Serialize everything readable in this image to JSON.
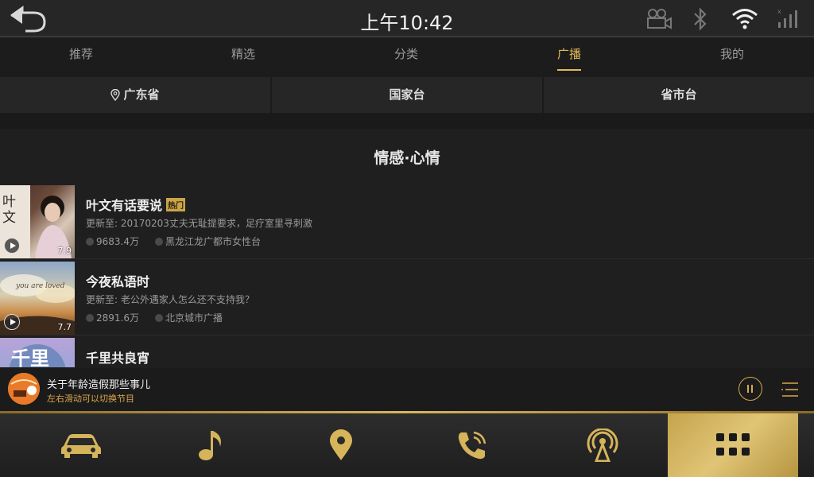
{
  "status_bar": {
    "time": "上午10:42",
    "icons": [
      "back-icon",
      "camera-icon",
      "bluetooth-icon",
      "wifi-icon",
      "signal-icon"
    ]
  },
  "tabs": [
    {
      "label": "推荐",
      "active": false
    },
    {
      "label": "精选",
      "active": false
    },
    {
      "label": "分类",
      "active": false
    },
    {
      "label": "广播",
      "active": true
    },
    {
      "label": "我的",
      "active": false
    }
  ],
  "filters": [
    {
      "label": "广东省",
      "icon": "location-pin-icon"
    },
    {
      "label": "国家台"
    },
    {
      "label": "省市台"
    }
  ],
  "section_title": "情感·心情",
  "programs": [
    {
      "title": "叶文有话要说",
      "badge": "热门",
      "update": "更新至: 20170203丈夫无耻提要求，足疗室里寻刺激",
      "plays": "9683.4万",
      "station": "黑龙江龙广都市女性台",
      "score": "7.9",
      "thumb_text": "叶文"
    },
    {
      "title": "今夜私语时",
      "badge": "",
      "update": "更新至: 老公外遇家人怎么还不支持我？",
      "plays": "2891.6万",
      "station": "北京城市广播",
      "score": "7.7",
      "thumb_text": "you are loved"
    },
    {
      "title": "千里共良宵",
      "badge": "",
      "update": "",
      "plays": "",
      "station": "",
      "score": "",
      "thumb_text": "千里"
    }
  ],
  "player": {
    "title": "关于年龄造假那些事儿",
    "hint": "左右滑动可以切换节目",
    "accent": "#d9a84a"
  },
  "dock": {
    "items": [
      "car-icon",
      "music-note-icon",
      "map-pin-icon",
      "phone-icon",
      "radio-antenna-icon",
      "apps-grid-icon"
    ],
    "active_index": 5
  },
  "colors": {
    "gold": "#e3b85a",
    "background": "#1f1f1f"
  }
}
